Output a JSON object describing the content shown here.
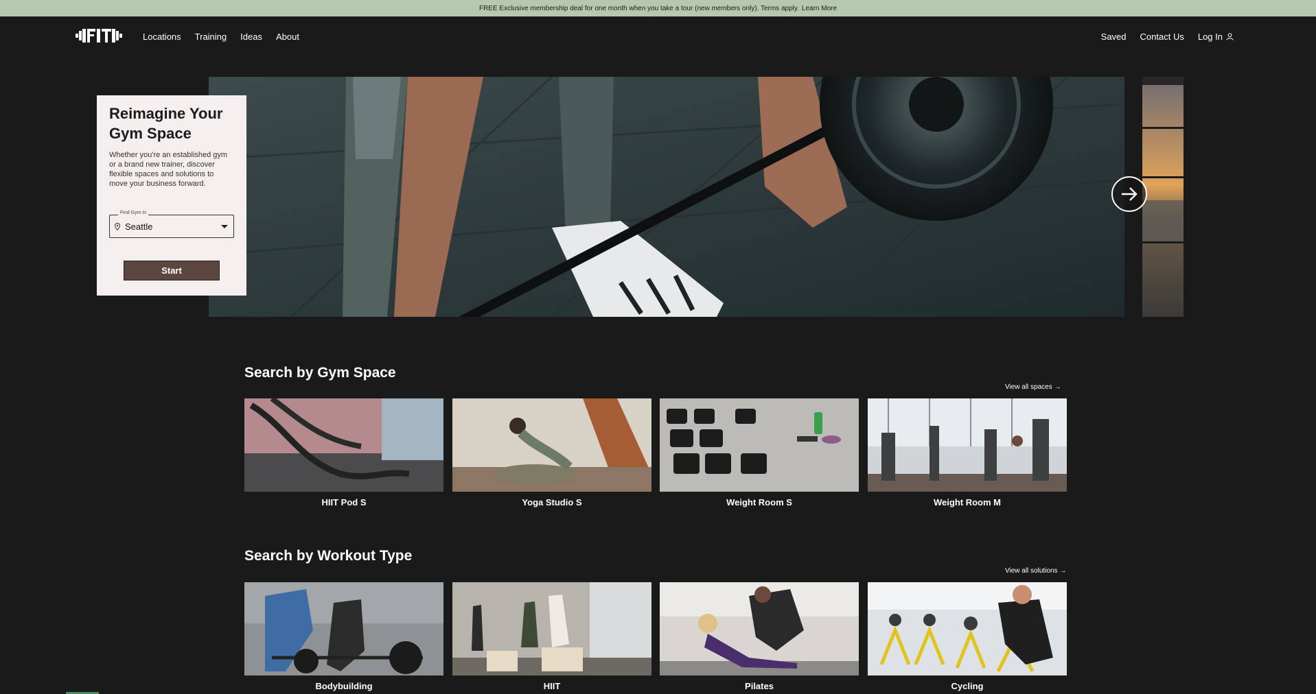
{
  "promo": {
    "text": "FREE Exclusive membership deal for one month when you take a tour (new members only). Terms apply.",
    "link": "Learn More"
  },
  "nav": {
    "logo_icon": "dumbbell-fit-logo",
    "left": [
      "Locations",
      "Training",
      "Ideas",
      "About"
    ],
    "right": [
      "Saved",
      "Contact Us",
      "Log In"
    ],
    "login_icon": "user-icon"
  },
  "hero_card": {
    "title": "Reimagine Your Gym Space",
    "description": "Whether you're an established gym or a brand new trainer, discover flexible spaces and solutions to move your business forward.",
    "field_label": "Find Gym In",
    "field_value": "Seattle",
    "start_label": "Start"
  },
  "hero": {
    "next_icon": "arrow-right-icon"
  },
  "gym_space": {
    "title": "Search by Gym Space",
    "view_all": "View all spaces →",
    "items": [
      "HIIT Pod S",
      "Yoga Studio S",
      "Weight Room S",
      "Weight Room M"
    ]
  },
  "workout_type": {
    "title": "Search by Workout Type",
    "view_all": "View all solutions →",
    "items": [
      "Bodybuilding",
      "HIIT",
      "Pilates",
      "Cycling"
    ]
  },
  "colors": {
    "promo_bg": "#b6c8ad",
    "page_bg": "#1a1a1a",
    "card_bg": "#f5eeee",
    "start_button": "#5c4640"
  }
}
